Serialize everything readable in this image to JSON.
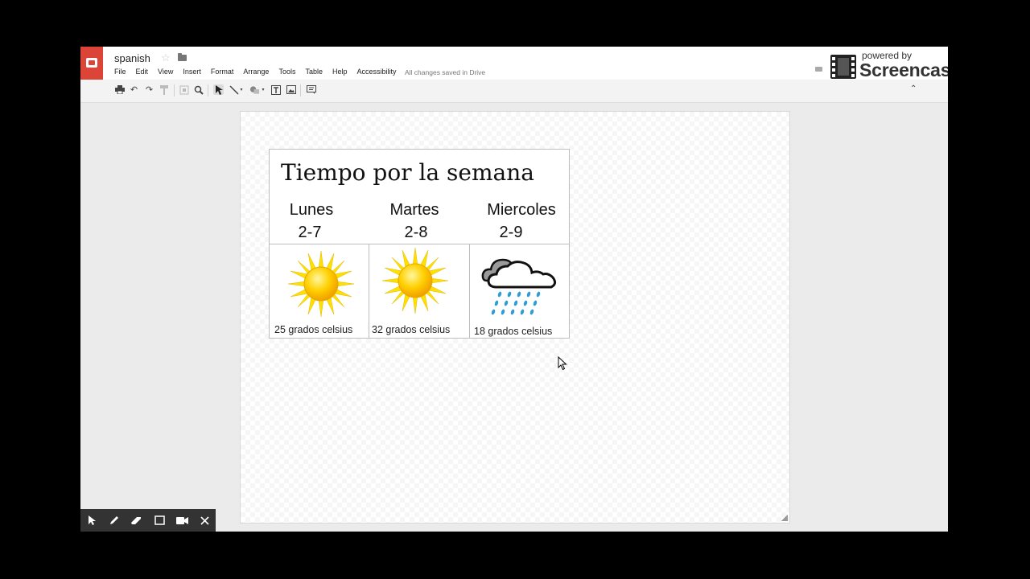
{
  "document": {
    "title": "spanish",
    "save_status": "All changes saved in Drive"
  },
  "menu": [
    "File",
    "Edit",
    "View",
    "Insert",
    "Format",
    "Arrange",
    "Tools",
    "Table",
    "Help",
    "Accessibility"
  ],
  "watermark": {
    "powered_by": "powered by",
    "brand": "Screencastify Lite"
  },
  "slide": {
    "title": "Tiempo por la semana",
    "days": [
      {
        "day": "Lunes",
        "date": "2-7",
        "condition": "sunny",
        "icon": "sun-icon",
        "caption": "25 grados celsius"
      },
      {
        "day": "Martes",
        "date": "2-8",
        "condition": "sunny",
        "icon": "sun-icon",
        "caption": "32 grados celsius"
      },
      {
        "day": "Miercoles",
        "date": "2-9",
        "condition": "rain",
        "icon": "rain-cloud-icon",
        "caption": "18 grados celsius"
      }
    ]
  },
  "colors": {
    "brand_red": "#db4437",
    "sun_yellow": "#ffd800",
    "rain_blue": "#2e9cd8"
  },
  "recorder_controls": [
    "pointer-icon",
    "pen-icon",
    "eraser-icon",
    "rectangle-icon",
    "camera-icon",
    "close-icon"
  ]
}
